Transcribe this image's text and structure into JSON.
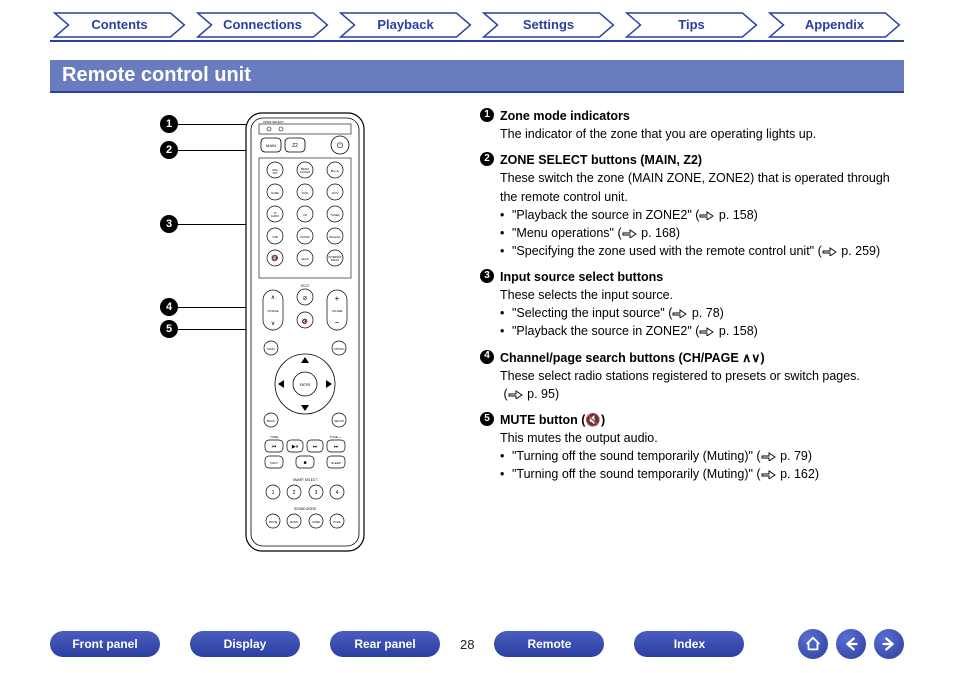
{
  "topnav": [
    "Contents",
    "Connections",
    "Playback",
    "Settings",
    "Tips",
    "Appendix"
  ],
  "title": "Remote control unit",
  "callout_labels": [
    "1",
    "2",
    "3",
    "4",
    "5"
  ],
  "items": [
    {
      "num": "1",
      "title": "Zone mode indicators",
      "body": "The indicator of the zone that you are operating lights up."
    },
    {
      "num": "2",
      "title": "ZONE SELECT buttons (MAIN, Z2)",
      "body": "These switch the zone (MAIN ZONE, ZONE2) that is operated through the remote control unit.",
      "bullets": [
        {
          "text": "\"Playback the source in ZONE2\" (",
          "page": "p. 158",
          "tail": ")"
        },
        {
          "text": "\"Menu operations\" (",
          "page": "p. 168",
          "tail": ")"
        },
        {
          "text": "\"Specifying the zone used with the remote control unit\" (",
          "page": "p. 259",
          "tail": ")"
        }
      ]
    },
    {
      "num": "3",
      "title": "Input source select buttons",
      "body": "These selects the input source.",
      "bullets": [
        {
          "text": "\"Selecting the input source\" (",
          "page": "p. 78",
          "tail": ")"
        },
        {
          "text": "\"Playback the source in ZONE2\" (",
          "page": "p. 158",
          "tail": ")"
        }
      ]
    },
    {
      "num": "4",
      "title": "Channel/page search buttons (CH/PAGE ∧∨)",
      "body": "These select radio stations registered to presets or switch pages.",
      "pageref": "p. 95"
    },
    {
      "num": "5",
      "title": "MUTE button (🔇)",
      "body": "This mutes the output audio.",
      "bullets": [
        {
          "text": "\"Turning off the sound temporarily (Muting)\" (",
          "page": "p. 79",
          "tail": ")"
        },
        {
          "text": "\"Turning off the sound temporarily (Muting)\" (",
          "page": "p. 162",
          "tail": ")"
        }
      ]
    }
  ],
  "footer": {
    "pills": [
      "Front panel",
      "Display",
      "Rear panel",
      "Remote",
      "Index"
    ],
    "page": "28"
  },
  "remote_face": {
    "zone_select_label": "ZONE SELECT",
    "zone_buttons": [
      "MAIN",
      "Z2"
    ],
    "power_icon": "⏻",
    "sources_row1": [
      "CBL/SAT",
      "MEDIA PLAYER",
      "Blu-ray"
    ],
    "sources_row2": [
      "GAME",
      "AUX1",
      "AUX2"
    ],
    "sources_row3": [
      "TV AUDIO",
      "CD",
      "TUNER"
    ],
    "sources_row4": [
      "USB",
      "PHONO",
      "Bluetooth"
    ],
    "sources_row5": [
      "🔇",
      "HEOS",
      "INTERNET RADIO"
    ],
    "eco_label": "ECO",
    "ch_page_label": "CH/PAGE",
    "volume_label": "VOLUME",
    "main_label": "MAIN",
    "enter_label": "ENTER",
    "back_label": "BACK",
    "setup_label": "SETUP",
    "option_label": "OPTION",
    "tune_minus": "TUNE -",
    "tune_plus": "TUNE +",
    "info_label": "INFO",
    "sleep_label": "SLEEP",
    "smart_select_label": "SMART SELECT",
    "smart_nums": [
      "1",
      "2",
      "3",
      "4"
    ],
    "sound_mode_label": "SOUND MODE",
    "sound_modes": [
      "MOVIE",
      "MUSIC",
      "GAME",
      "PURE"
    ]
  }
}
